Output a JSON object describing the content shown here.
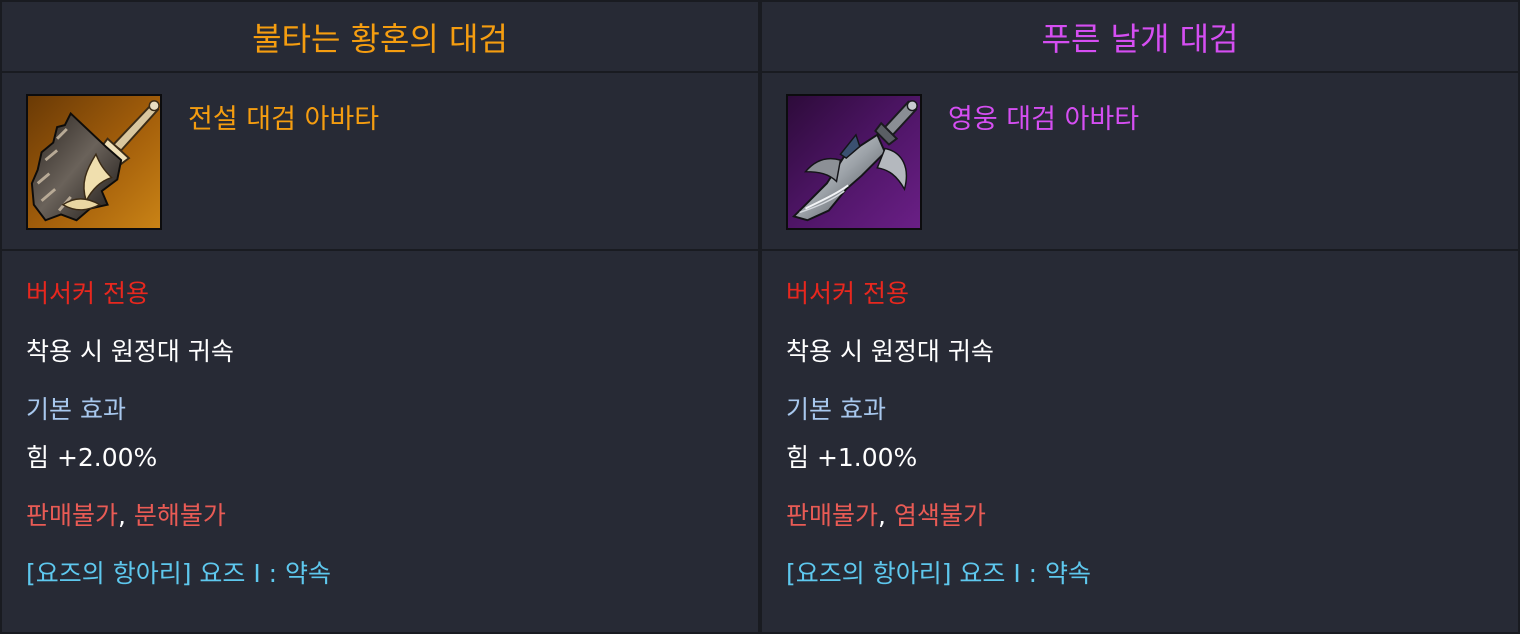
{
  "colors": {
    "legend": "#f59d10",
    "hero": "#d54ef2",
    "class": "#e8271e",
    "effect_header": "#a8c8ee",
    "restriction": "#e95b55",
    "set": "#5ec8ee"
  },
  "cards": [
    {
      "title": "불타는 황혼의 대검",
      "grade_color": "#f59d10",
      "avatar_name": "전설 대검 아바타",
      "icon": "flaming-greatsword-icon",
      "class_only": "버서커 전용",
      "bind": "착용 시 원정대 귀속",
      "effect_header": "기본 효과",
      "stat": "힘 +2.00%",
      "restriction_1": "판매불가",
      "separator": ",",
      "restriction_2": "분해불가",
      "set_effect": "[요즈의 항아리] 요즈 I : 약속"
    },
    {
      "title": "푸른 날개 대검",
      "grade_color": "#d54ef2",
      "avatar_name": "영웅 대검 아바타",
      "icon": "winged-greatsword-icon",
      "class_only": "버서커 전용",
      "bind": "착용 시 원정대 귀속",
      "effect_header": "기본 효과",
      "stat": "힘 +1.00%",
      "restriction_1": "판매불가",
      "separator": ",",
      "restriction_2": "염색불가",
      "set_effect": "[요즈의 항아리] 요즈 I : 약속"
    }
  ]
}
